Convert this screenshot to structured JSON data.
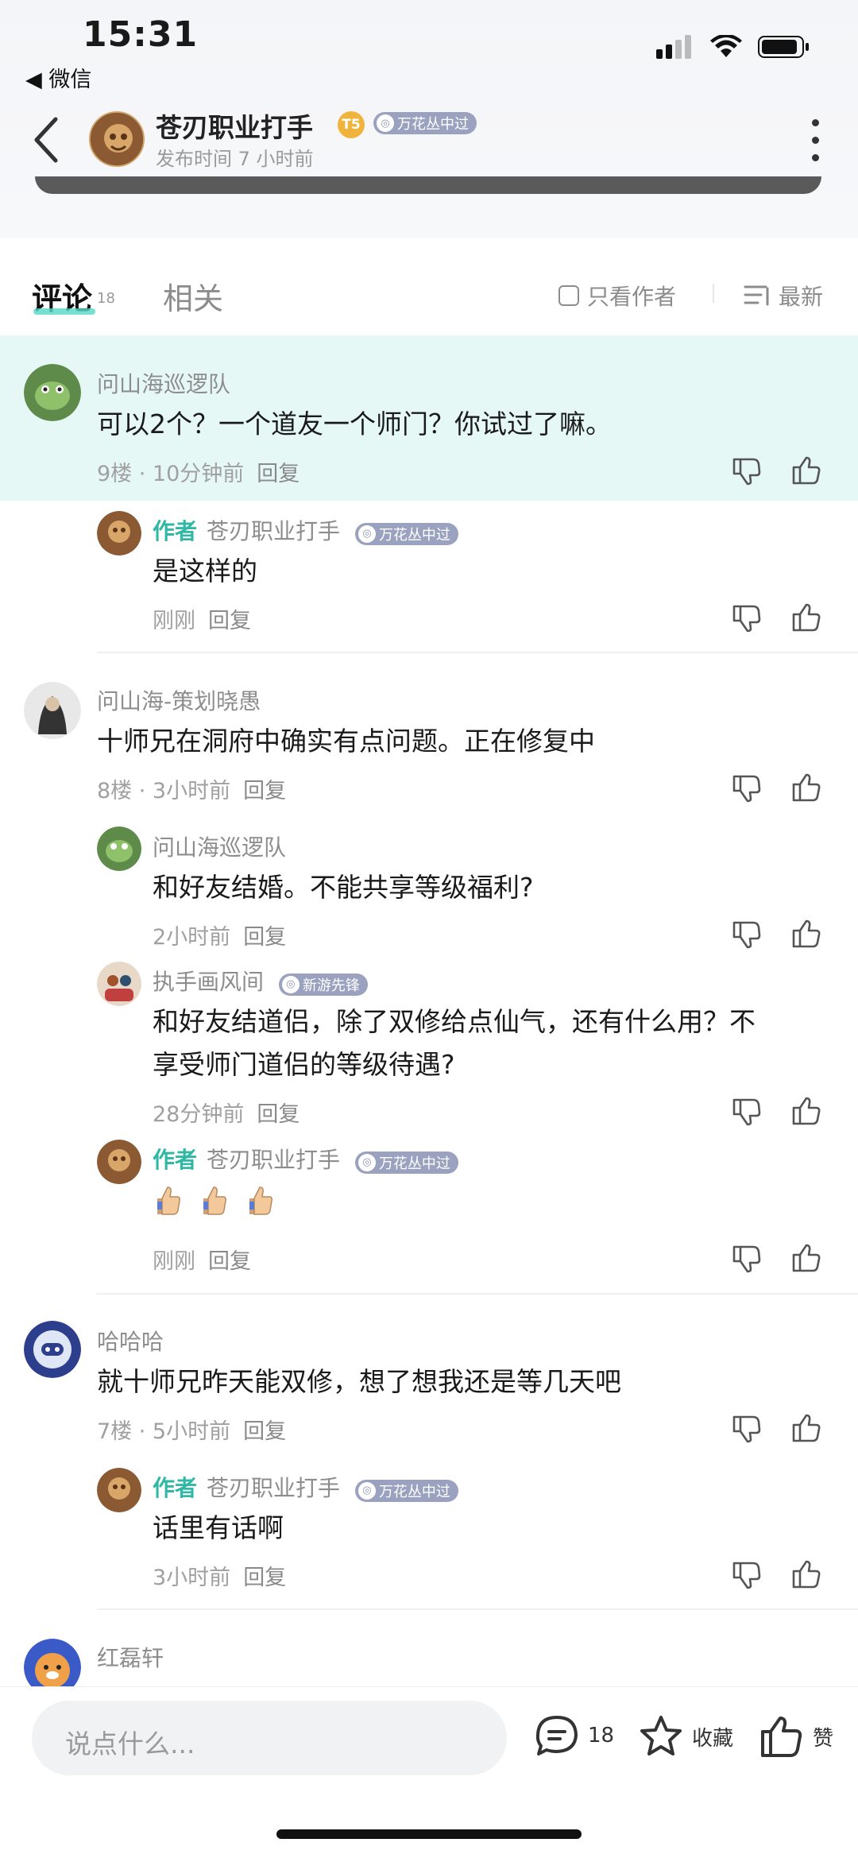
{
  "status_bar": {
    "time": "15:31",
    "back_app": "◀ 微信"
  },
  "header": {
    "author_name": "苍刃职业打手",
    "level_badge": "T5",
    "tag": "万花丛中过",
    "publish_time": "发布时间 7 小时前"
  },
  "tabs": {
    "comment_label": "评论",
    "comment_count": "18",
    "related_label": "相关",
    "only_author": "只看作者",
    "sort": "最新"
  },
  "comments": [
    {
      "name": "问山海巡逻队",
      "content": "可以2个？一个道友一个师门？你试过了嘛。",
      "time": "9楼 · 10分钟前",
      "reply": "回复"
    },
    {
      "author_label": "作者",
      "name": "苍刃职业打手",
      "tag": "万花丛中过",
      "content": "是这样的",
      "time": "刚刚",
      "reply": "回复"
    },
    {
      "name": "问山海-策划晓愚",
      "content": "十师兄在洞府中确实有点问题。正在修复中",
      "time": "8楼 · 3小时前",
      "reply": "回复"
    },
    {
      "name": "问山海巡逻队",
      "content": "和好友结婚。不能共享等级福利?",
      "time": "2小时前",
      "reply": "回复"
    },
    {
      "name": "执手画风间",
      "tag": "新游先锋",
      "content_line1": "和好友结道侣，除了双修给点仙气，还有什么用？不",
      "content_line2": "享受师门道侣的等级待遇?",
      "time": "28分钟前",
      "reply": "回复"
    },
    {
      "author_label": "作者",
      "name": "苍刃职业打手",
      "tag": "万花丛中过",
      "content": "",
      "time": "刚刚",
      "reply": "回复"
    },
    {
      "name": "哈哈哈",
      "content": "就十师兄昨天能双修，想了想我还是等几天吧",
      "time": "7楼 · 5小时前",
      "reply": "回复"
    },
    {
      "author_label": "作者",
      "name": "苍刃职业打手",
      "tag": "万花丛中过",
      "content": "话里有话啊",
      "time": "3小时前",
      "reply": "回复"
    },
    {
      "name": "红磊轩"
    }
  ],
  "bottom_bar": {
    "placeholder": "说点什么...",
    "comment_count": "18",
    "collect_label": "收藏",
    "like_label": "赞"
  },
  "colors": {
    "accent": "#2fb9a5",
    "highlight": "#e6f8f6",
    "tag": "#9aa2bf"
  }
}
